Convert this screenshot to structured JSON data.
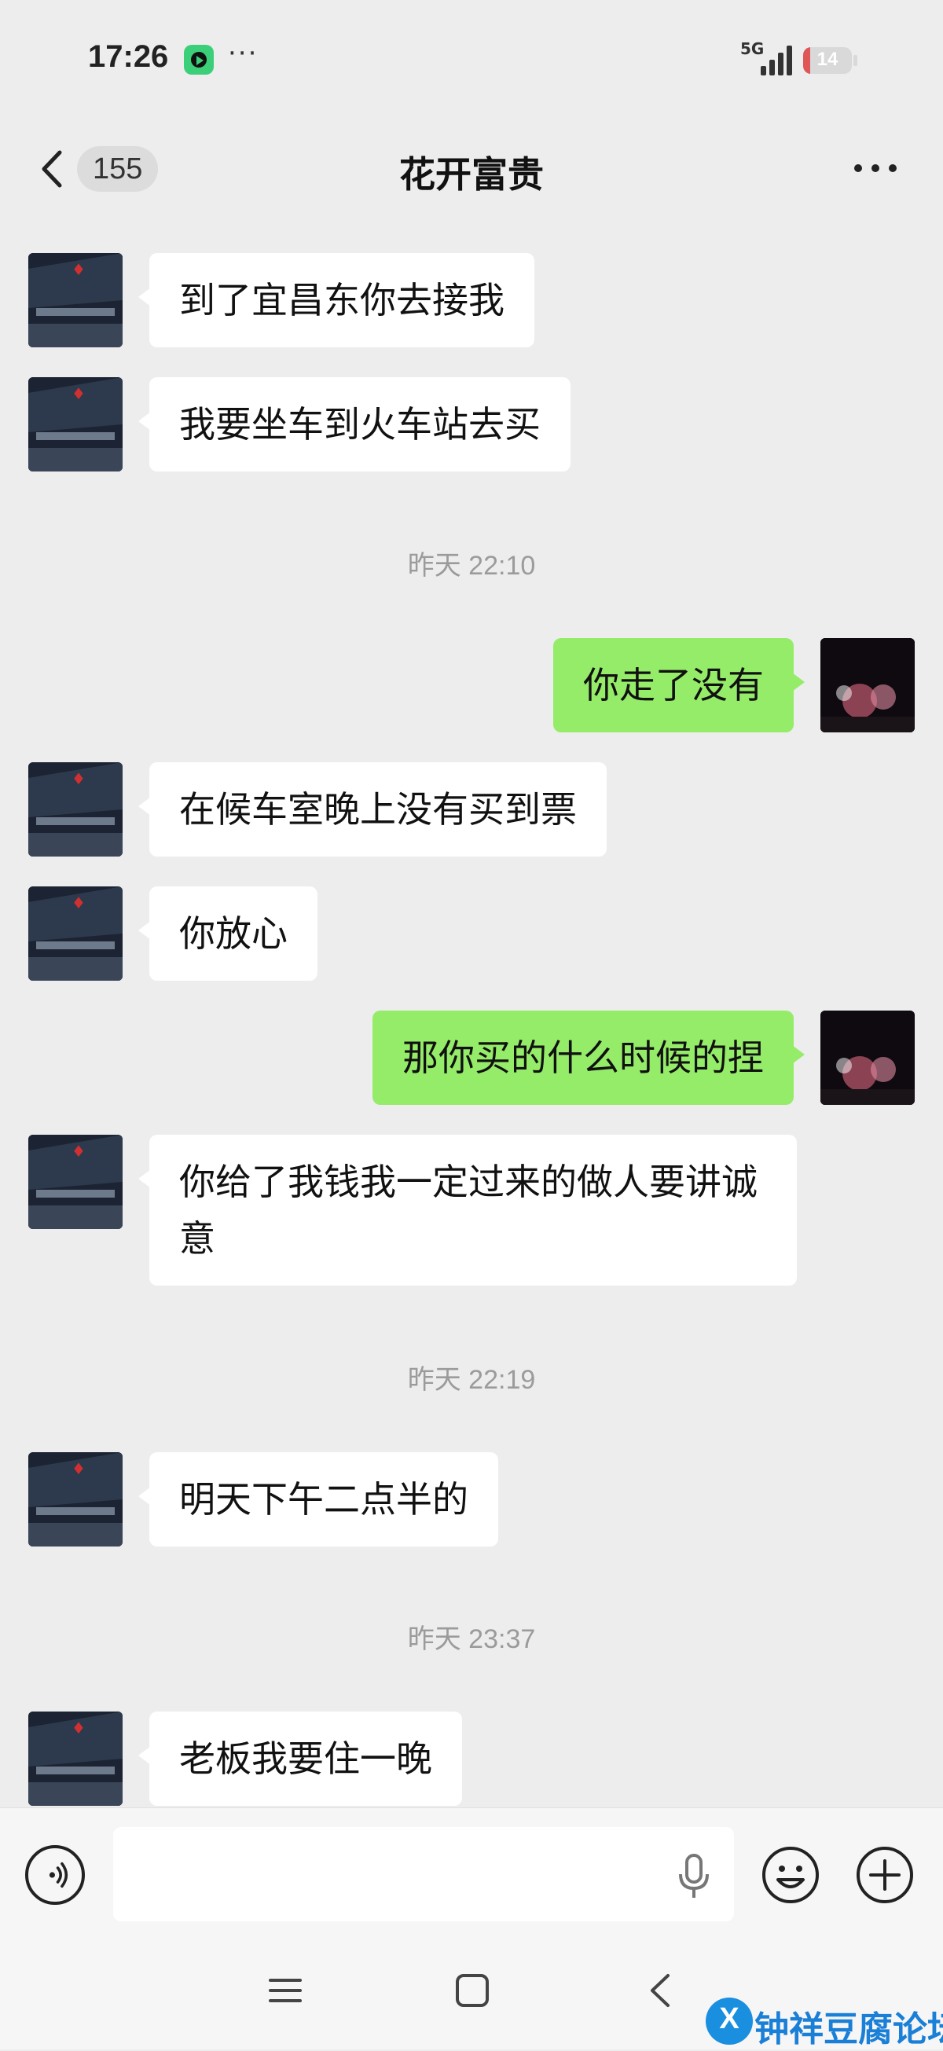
{
  "status_bar": {
    "time": "17:26",
    "more": "···",
    "network": "5G",
    "battery": "14",
    "battery_level": 0.14
  },
  "header": {
    "unread_count": "155",
    "title": "花开富贵"
  },
  "messages": [
    {
      "type": "text",
      "side": "in",
      "text": "到了宜昌东你去接我"
    },
    {
      "type": "text",
      "side": "in",
      "text": "我要坐车到火车站去买"
    },
    {
      "type": "time",
      "text": "昨天 22:10"
    },
    {
      "type": "text",
      "side": "out",
      "text": "你走了没有"
    },
    {
      "type": "text",
      "side": "in",
      "text": "在候车室晚上没有买到票"
    },
    {
      "type": "text",
      "side": "in",
      "text": "你放心"
    },
    {
      "type": "text",
      "side": "out",
      "text": "那你买的什么时候的捏"
    },
    {
      "type": "text",
      "side": "in",
      "text": "你给了我钱我一定过来的做人要讲诚意"
    },
    {
      "type": "time",
      "text": "昨天 22:19"
    },
    {
      "type": "text",
      "side": "in",
      "text": "明天下午二点半的"
    },
    {
      "type": "time",
      "text": "昨天 23:37"
    },
    {
      "type": "text",
      "side": "in",
      "text": "老板我要住一晚"
    }
  ],
  "input": {
    "value": "",
    "placeholder": ""
  },
  "watermark": {
    "text": "钟祥豆腐论坛"
  },
  "colors": {
    "background": "#ededed",
    "incoming_bubble": "#ffffff",
    "outgoing_bubble": "#95ec69",
    "timestamp": "#9b9b9b",
    "watermark": "#1a7fd6"
  },
  "icons": [
    "back-icon",
    "more-menu-icon",
    "voice-icon",
    "mic-icon",
    "emoji-icon",
    "plus-icon",
    "nav-menu-icon",
    "nav-home-icon",
    "nav-back-icon"
  ]
}
